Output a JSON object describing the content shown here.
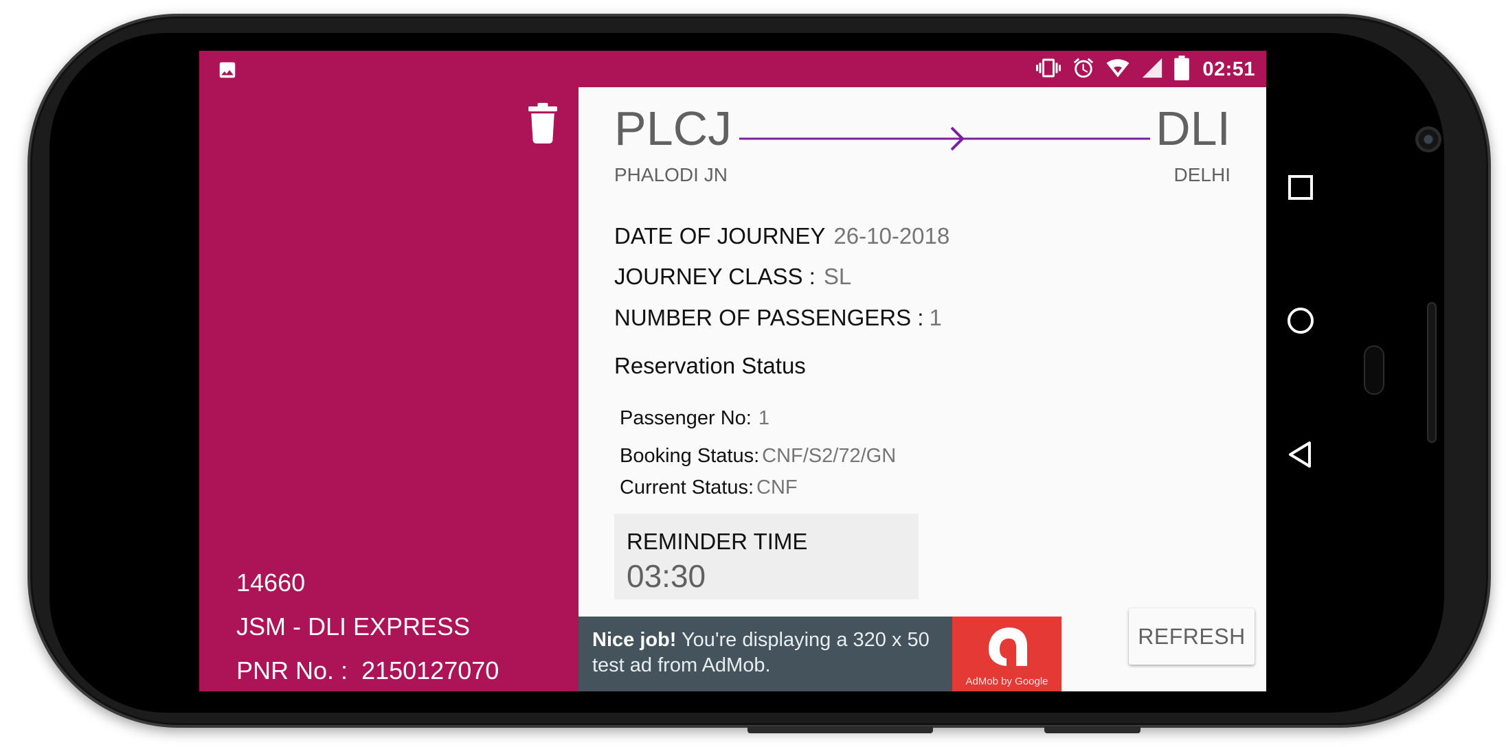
{
  "status_bar": {
    "time": "02:51",
    "icons": [
      "image-icon",
      "vibrate-icon",
      "alarm-icon",
      "wifi-icon",
      "signal-icon",
      "battery-icon"
    ]
  },
  "colors": {
    "primary": "#ad1457",
    "route_arrow": "#7b1fa2",
    "ad_background": "#45535d",
    "ad_logo": "#e53935"
  },
  "left_panel": {
    "train_number": "14660",
    "train_name": "JSM - DLI EXPRESS",
    "pnr_label": "PNR No. :",
    "pnr_value": "2150127070",
    "delete_icon": "trash-icon"
  },
  "route": {
    "from_code": "PLCJ",
    "from_name": "PHALODI JN",
    "to_code": "DLI",
    "to_name": "DELHI"
  },
  "journey": {
    "date_label": "DATE OF JOURNEY",
    "date_value": "26-10-2018",
    "class_label": "JOURNEY CLASS :",
    "class_value": "SL",
    "passengers_label": "NUMBER OF PASSENGERS :",
    "passengers_value": "1"
  },
  "reservation": {
    "title": "Reservation Status",
    "passenger_no_label": "Passenger No:",
    "passenger_no_value": "1",
    "booking_status_label": "Booking Status:",
    "booking_status_value": "CNF/S2/72/GN",
    "current_status_label": "Current Status:",
    "current_status_value": "CNF"
  },
  "reminder": {
    "label": "REMINDER TIME",
    "time": "03:30"
  },
  "ad": {
    "bold": "Nice job!",
    "text": " You're displaying a 320 x 50 test ad from AdMob.",
    "logo_caption": "AdMob by Google"
  },
  "refresh_label": "REFRESH",
  "nav_bar": {
    "icons": [
      "recents-icon",
      "home-icon",
      "back-icon"
    ]
  }
}
